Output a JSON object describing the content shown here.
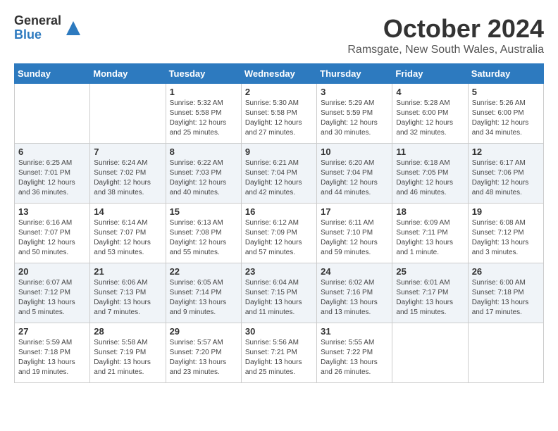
{
  "header": {
    "logo_general": "General",
    "logo_blue": "Blue",
    "month_title": "October 2024",
    "subtitle": "Ramsgate, New South Wales, Australia"
  },
  "weekdays": [
    "Sunday",
    "Monday",
    "Tuesday",
    "Wednesday",
    "Thursday",
    "Friday",
    "Saturday"
  ],
  "weeks": [
    [
      {
        "day": "",
        "info": ""
      },
      {
        "day": "",
        "info": ""
      },
      {
        "day": "1",
        "info": "Sunrise: 5:32 AM\nSunset: 5:58 PM\nDaylight: 12 hours and 25 minutes."
      },
      {
        "day": "2",
        "info": "Sunrise: 5:30 AM\nSunset: 5:58 PM\nDaylight: 12 hours and 27 minutes."
      },
      {
        "day": "3",
        "info": "Sunrise: 5:29 AM\nSunset: 5:59 PM\nDaylight: 12 hours and 30 minutes."
      },
      {
        "day": "4",
        "info": "Sunrise: 5:28 AM\nSunset: 6:00 PM\nDaylight: 12 hours and 32 minutes."
      },
      {
        "day": "5",
        "info": "Sunrise: 5:26 AM\nSunset: 6:00 PM\nDaylight: 12 hours and 34 minutes."
      }
    ],
    [
      {
        "day": "6",
        "info": "Sunrise: 6:25 AM\nSunset: 7:01 PM\nDaylight: 12 hours and 36 minutes."
      },
      {
        "day": "7",
        "info": "Sunrise: 6:24 AM\nSunset: 7:02 PM\nDaylight: 12 hours and 38 minutes."
      },
      {
        "day": "8",
        "info": "Sunrise: 6:22 AM\nSunset: 7:03 PM\nDaylight: 12 hours and 40 minutes."
      },
      {
        "day": "9",
        "info": "Sunrise: 6:21 AM\nSunset: 7:04 PM\nDaylight: 12 hours and 42 minutes."
      },
      {
        "day": "10",
        "info": "Sunrise: 6:20 AM\nSunset: 7:04 PM\nDaylight: 12 hours and 44 minutes."
      },
      {
        "day": "11",
        "info": "Sunrise: 6:18 AM\nSunset: 7:05 PM\nDaylight: 12 hours and 46 minutes."
      },
      {
        "day": "12",
        "info": "Sunrise: 6:17 AM\nSunset: 7:06 PM\nDaylight: 12 hours and 48 minutes."
      }
    ],
    [
      {
        "day": "13",
        "info": "Sunrise: 6:16 AM\nSunset: 7:07 PM\nDaylight: 12 hours and 50 minutes."
      },
      {
        "day": "14",
        "info": "Sunrise: 6:14 AM\nSunset: 7:07 PM\nDaylight: 12 hours and 53 minutes."
      },
      {
        "day": "15",
        "info": "Sunrise: 6:13 AM\nSunset: 7:08 PM\nDaylight: 12 hours and 55 minutes."
      },
      {
        "day": "16",
        "info": "Sunrise: 6:12 AM\nSunset: 7:09 PM\nDaylight: 12 hours and 57 minutes."
      },
      {
        "day": "17",
        "info": "Sunrise: 6:11 AM\nSunset: 7:10 PM\nDaylight: 12 hours and 59 minutes."
      },
      {
        "day": "18",
        "info": "Sunrise: 6:09 AM\nSunset: 7:11 PM\nDaylight: 13 hours and 1 minute."
      },
      {
        "day": "19",
        "info": "Sunrise: 6:08 AM\nSunset: 7:12 PM\nDaylight: 13 hours and 3 minutes."
      }
    ],
    [
      {
        "day": "20",
        "info": "Sunrise: 6:07 AM\nSunset: 7:12 PM\nDaylight: 13 hours and 5 minutes."
      },
      {
        "day": "21",
        "info": "Sunrise: 6:06 AM\nSunset: 7:13 PM\nDaylight: 13 hours and 7 minutes."
      },
      {
        "day": "22",
        "info": "Sunrise: 6:05 AM\nSunset: 7:14 PM\nDaylight: 13 hours and 9 minutes."
      },
      {
        "day": "23",
        "info": "Sunrise: 6:04 AM\nSunset: 7:15 PM\nDaylight: 13 hours and 11 minutes."
      },
      {
        "day": "24",
        "info": "Sunrise: 6:02 AM\nSunset: 7:16 PM\nDaylight: 13 hours and 13 minutes."
      },
      {
        "day": "25",
        "info": "Sunrise: 6:01 AM\nSunset: 7:17 PM\nDaylight: 13 hours and 15 minutes."
      },
      {
        "day": "26",
        "info": "Sunrise: 6:00 AM\nSunset: 7:18 PM\nDaylight: 13 hours and 17 minutes."
      }
    ],
    [
      {
        "day": "27",
        "info": "Sunrise: 5:59 AM\nSunset: 7:18 PM\nDaylight: 13 hours and 19 minutes."
      },
      {
        "day": "28",
        "info": "Sunrise: 5:58 AM\nSunset: 7:19 PM\nDaylight: 13 hours and 21 minutes."
      },
      {
        "day": "29",
        "info": "Sunrise: 5:57 AM\nSunset: 7:20 PM\nDaylight: 13 hours and 23 minutes."
      },
      {
        "day": "30",
        "info": "Sunrise: 5:56 AM\nSunset: 7:21 PM\nDaylight: 13 hours and 25 minutes."
      },
      {
        "day": "31",
        "info": "Sunrise: 5:55 AM\nSunset: 7:22 PM\nDaylight: 13 hours and 26 minutes."
      },
      {
        "day": "",
        "info": ""
      },
      {
        "day": "",
        "info": ""
      }
    ]
  ]
}
